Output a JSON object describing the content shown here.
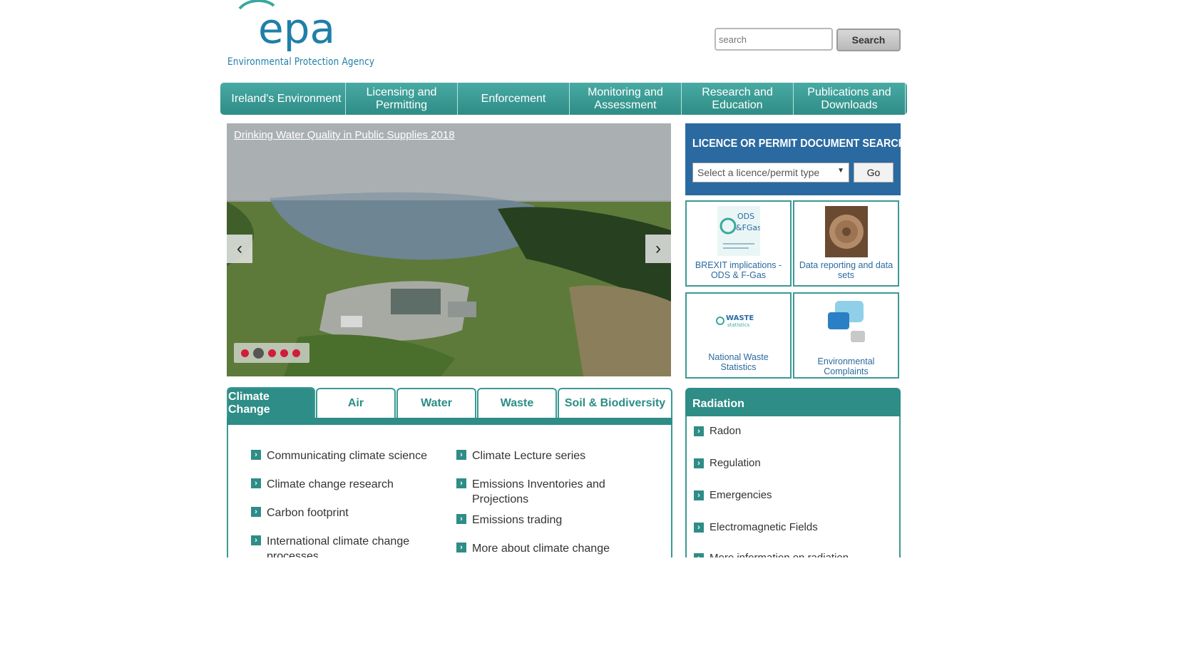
{
  "logo": {
    "wordmark": "epa",
    "subtitle": "Environmental Protection Agency"
  },
  "search": {
    "placeholder": "search",
    "button_label": "Search"
  },
  "nav": {
    "items": [
      "Ireland's Environment",
      "Licensing and Permitting",
      "Enforcement",
      "Monitoring and Assessment",
      "Research and Education",
      "Publications and Downloads"
    ]
  },
  "slider": {
    "caption": "Drinking Water Quality in Public Supplies 2018",
    "prev_icon": "chevron-left-icon",
    "next_icon": "chevron-right-icon",
    "prev_glyph": "‹",
    "next_glyph": "›",
    "dots": 5,
    "active_dot": 2
  },
  "licence": {
    "title": "LICENCE OR PERMIT DOCUMENT SEARCH",
    "select_value": "Select a licence/permit type",
    "go_label": "Go"
  },
  "tiles": [
    {
      "caption": "BREXIT implications - ODS & F-Gas",
      "icon": "ods-fgas-icon"
    },
    {
      "caption": "Data reporting and data sets",
      "icon": "sea-urchin-icon"
    },
    {
      "caption": "National Waste Statistics",
      "icon": "waste-statistics-icon"
    },
    {
      "caption": "Environmental Complaints",
      "icon": "speech-bubbles-icon"
    }
  ],
  "tabs": {
    "items": [
      "Climate Change",
      "Air",
      "Water",
      "Waste",
      "Soil & Biodiversity"
    ],
    "active": 0,
    "links_left": [
      "Communicating climate science",
      "Climate change research",
      "Carbon footprint",
      "International climate change processes"
    ],
    "links_right": [
      "Climate Lecture series",
      "Emissions Inventories and Projections",
      "Emissions trading",
      "More about climate change"
    ]
  },
  "radiation": {
    "title": "Radiation",
    "items": [
      "Radon",
      "Regulation",
      "Emergencies",
      "Electromagnetic Fields",
      "More information on radiation"
    ]
  },
  "colors": {
    "brand_teal": "#2e8d86",
    "licence_blue": "#2b6aa0",
    "dot_red": "#d31c3b"
  }
}
